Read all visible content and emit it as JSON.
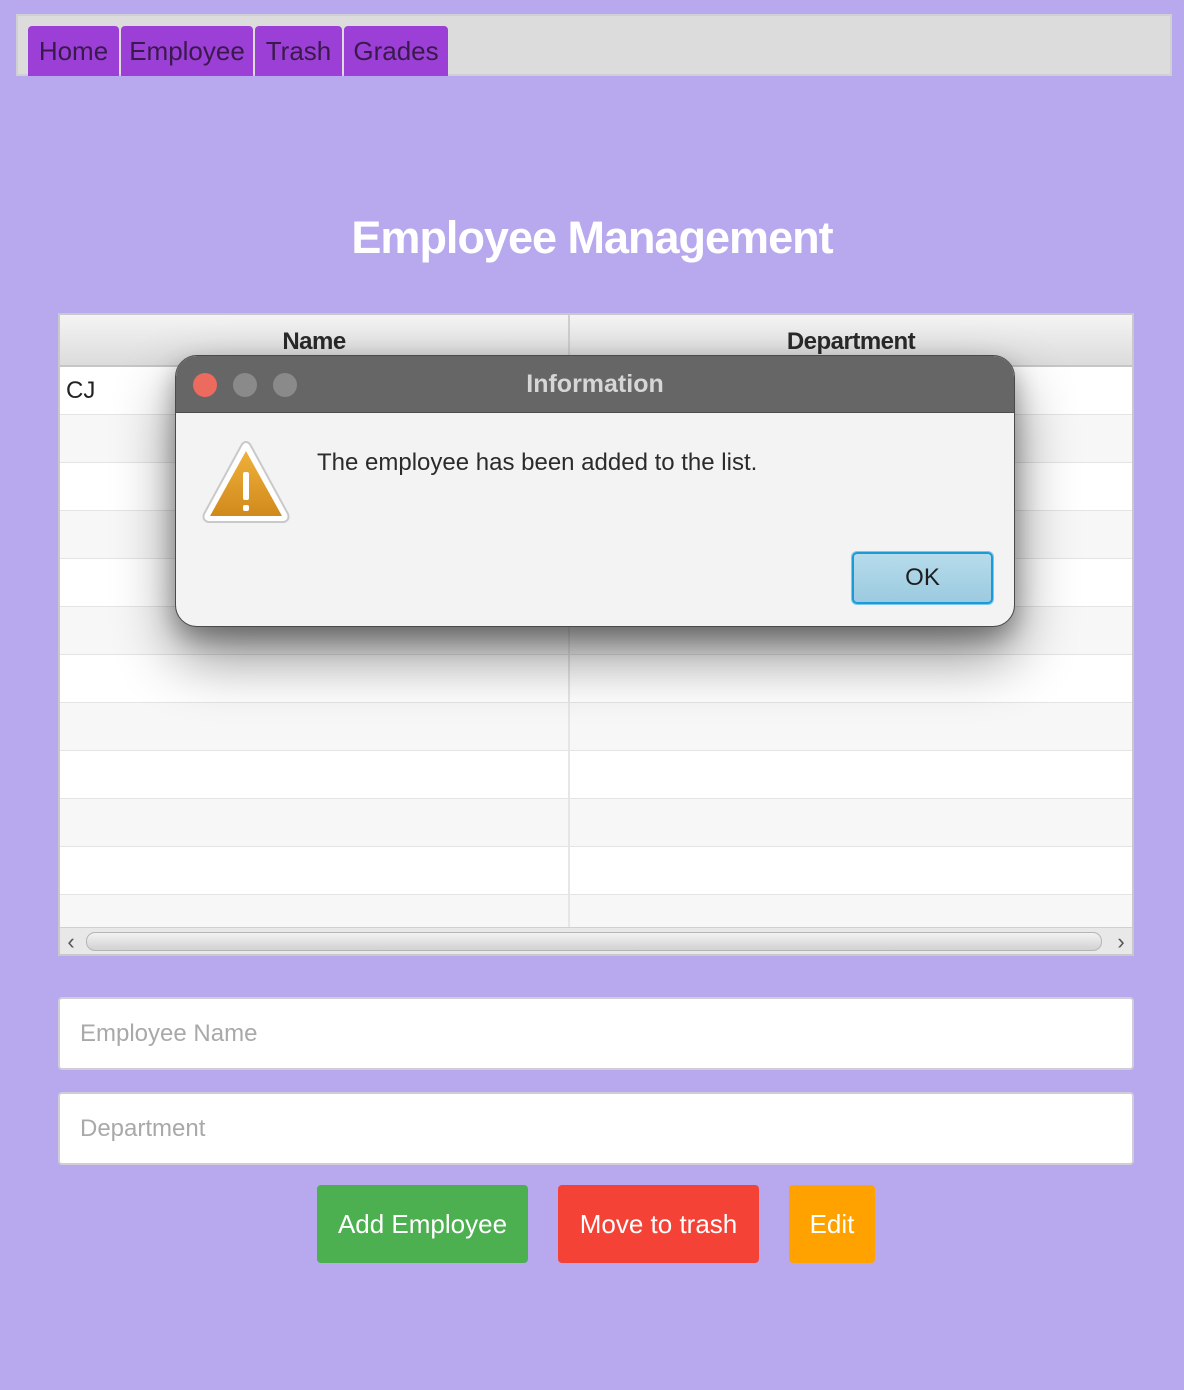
{
  "tabs": [
    {
      "label": "Home"
    },
    {
      "label": "Employee"
    },
    {
      "label": "Trash"
    },
    {
      "label": "Grades"
    }
  ],
  "page": {
    "title": "Employee Management"
  },
  "table": {
    "columns": [
      "Name",
      "Department"
    ],
    "rows": [
      {
        "name": "CJ",
        "department": ""
      },
      {
        "name": "",
        "department": ""
      },
      {
        "name": "",
        "department": ""
      },
      {
        "name": "",
        "department": ""
      },
      {
        "name": "",
        "department": ""
      },
      {
        "name": "",
        "department": ""
      },
      {
        "name": "",
        "department": ""
      },
      {
        "name": "",
        "department": ""
      },
      {
        "name": "",
        "department": ""
      },
      {
        "name": "",
        "department": ""
      },
      {
        "name": "",
        "department": ""
      },
      {
        "name": "",
        "department": ""
      }
    ],
    "scroll_left_icon": "chevron-left-icon",
    "scroll_right_icon": "chevron-right-icon"
  },
  "form": {
    "name_placeholder": "Employee Name",
    "name_value": "",
    "department_placeholder": "Department",
    "department_value": ""
  },
  "buttons": {
    "add_label": "Add Employee",
    "trash_label": "Move to trash",
    "edit_label": "Edit"
  },
  "dialog": {
    "title": "Information",
    "message": "The employee has been added to the list.",
    "ok_label": "OK",
    "icon": "warning-icon"
  },
  "colors": {
    "background": "#b8a8ee",
    "tab": "#9b3fd6",
    "add_button": "#4caf50",
    "trash_button": "#f44336",
    "edit_button": "#ffa200",
    "close_light": "#ec6a5e",
    "inactive_light": "#8a8a8a"
  }
}
